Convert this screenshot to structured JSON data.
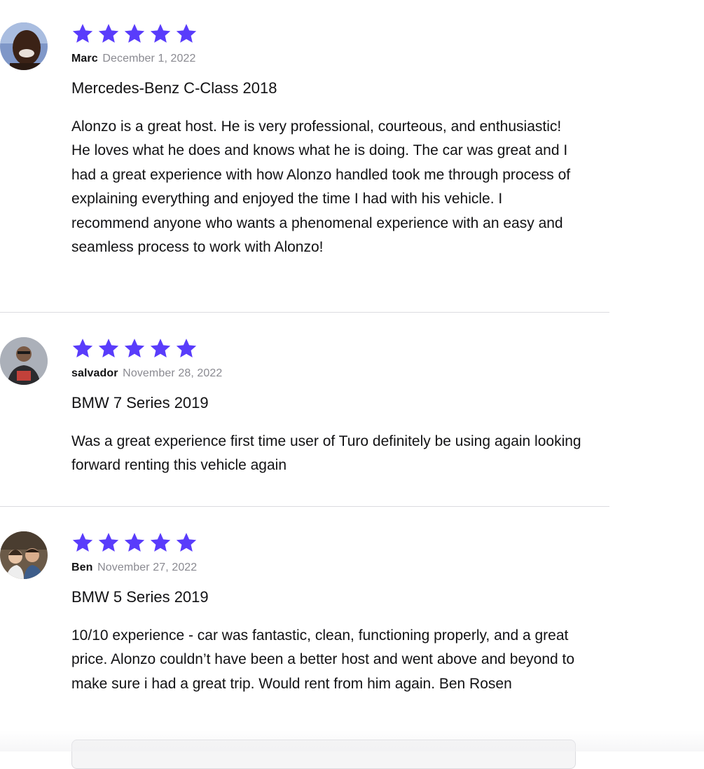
{
  "colors": {
    "star": "#593cfb",
    "divider": "#dcdce0",
    "date": "#8a8a91",
    "text": "#121214"
  },
  "reviews": [
    {
      "rating": 5,
      "author": "Marc",
      "date": "December 1, 2022",
      "vehicle": "Mercedes-Benz C-Class 2018",
      "text": "Alonzo is a great host. He is very professional, courteous, and enthusiastic! He loves what he does and knows what he is doing. The car was great and I had a great experience with how Alonzo handled took me through process of explaining everything and enjoyed the time I had with his vehicle. I recommend anyone who wants a phenomenal experience with an easy and seamless process to work with Alonzo!"
    },
    {
      "rating": 5,
      "author": "salvador",
      "date": "November 28, 2022",
      "vehicle": "BMW 7 Series 2019",
      "text": "Was a great experience first time user of Turo definitely be using again looking forward renting this vehicle again"
    },
    {
      "rating": 5,
      "author": "Ben",
      "date": "November 27, 2022",
      "vehicle": "BMW 5 Series 2019",
      "text": "10/10 experience - car was fantastic, clean, functioning properly, and a great price. Alonzo couldn’t have been a better host and went above and beyond to make sure i had a great trip. Would rent from him again. Ben Rosen"
    }
  ]
}
